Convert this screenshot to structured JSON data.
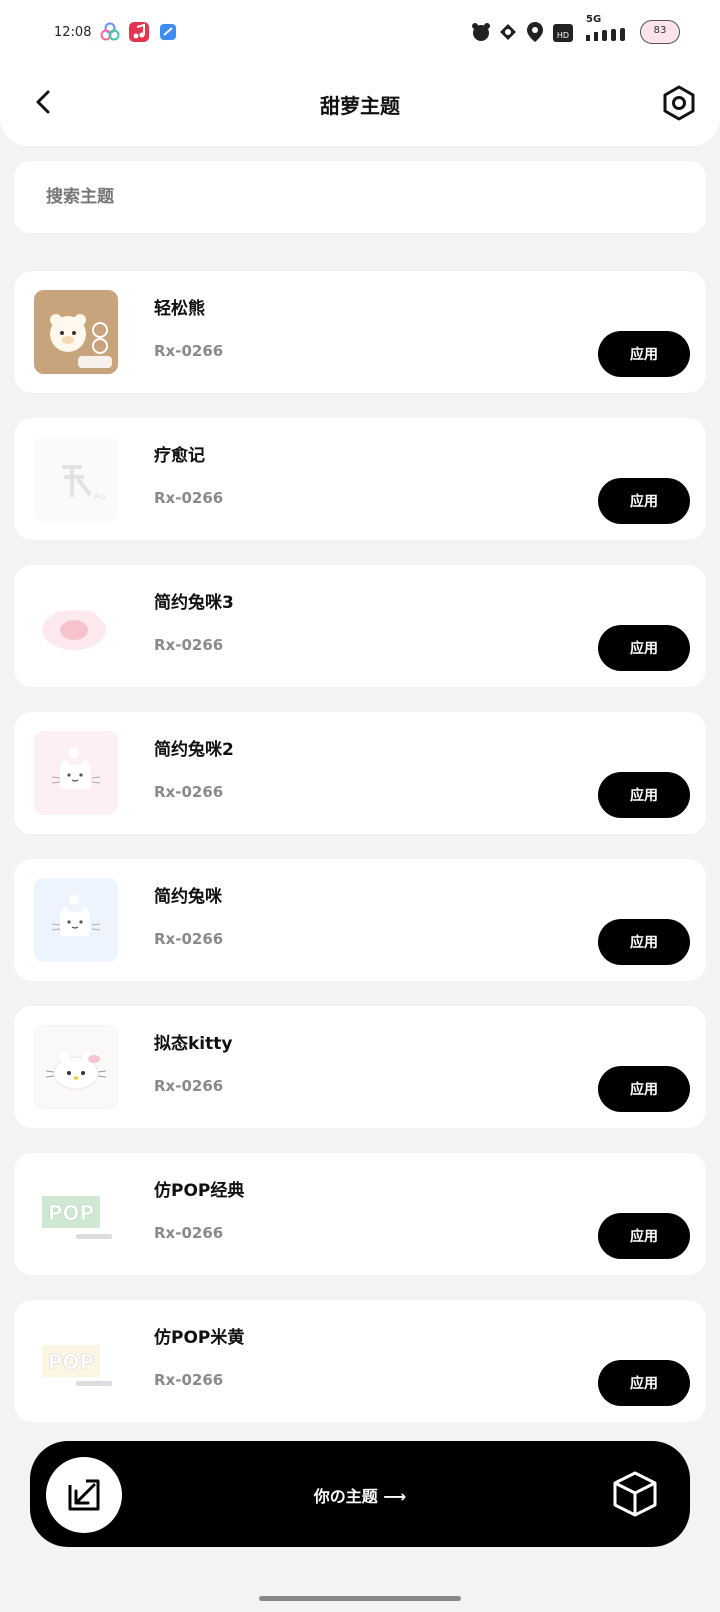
{
  "status_bar": {
    "time": "12:08",
    "network": "5G",
    "battery": "83"
  },
  "header": {
    "title": "甜萝主题",
    "back_icon": "chevron-left-icon",
    "settings_icon": "hexagon-gear-icon"
  },
  "search": {
    "placeholder": "搜索主题",
    "value": ""
  },
  "themes": [
    {
      "name": "轻松熊",
      "code": "Rx-0266",
      "apply_label": "应用",
      "thumb": "bear"
    },
    {
      "name": "疗愈记",
      "code": "Rx-0266",
      "apply_label": "应用",
      "thumb": "faded"
    },
    {
      "name": "简约兔咪3",
      "code": "Rx-0266",
      "apply_label": "应用",
      "thumb": "pink-bunny"
    },
    {
      "name": "简约兔咪2",
      "code": "Rx-0266",
      "apply_label": "应用",
      "thumb": "pink-cat"
    },
    {
      "name": "简约兔咪",
      "code": "Rx-0266",
      "apply_label": "应用",
      "thumb": "blue-cat"
    },
    {
      "name": "拟态kitty",
      "code": "Rx-0266",
      "apply_label": "应用",
      "thumb": "kitty"
    },
    {
      "name": "仿POP经典",
      "code": "Rx-0266",
      "apply_label": "应用",
      "thumb": "pop-green"
    },
    {
      "name": "仿POP米黄",
      "code": "Rx-0266",
      "apply_label": "应用",
      "thumb": "pop-beige"
    }
  ],
  "bottom_bar": {
    "label": "你の主题 ⟶",
    "left_icon": "import-arrow-icon",
    "right_icon": "cube-icon"
  },
  "colors": {
    "background": "#f3f3f3",
    "card": "#ffffff",
    "button": "#000000",
    "code_text": "#8a8a8a"
  }
}
